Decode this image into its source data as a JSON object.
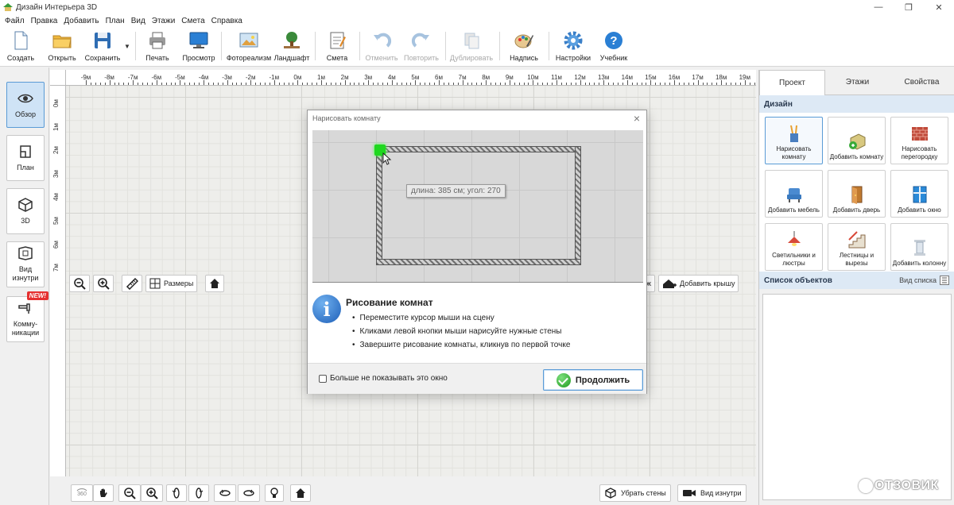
{
  "window": {
    "title": "Дизайн Интерьера 3D"
  },
  "menu": [
    "Файл",
    "Правка",
    "Добавить",
    "План",
    "Вид",
    "Этажи",
    "Смета",
    "Справка"
  ],
  "toolbar": {
    "create": "Создать",
    "open": "Открыть",
    "save": "Сохранить",
    "print": "Печать",
    "preview": "Просмотр",
    "photo": "Фотореализм",
    "landscape": "Ландшафт",
    "estimate": "Смета",
    "undo": "Отменить",
    "redo": "Повторить",
    "duplicate": "Дублировать",
    "label": "Надпись",
    "settings": "Настройки",
    "tutorial": "Учебник"
  },
  "left_nav": {
    "overview": "Обзор",
    "plan": "План",
    "three_d": "3D",
    "inside_view": "Вид изнутри",
    "communications": "Комму-никации",
    "new_badge": "NEW!"
  },
  "ruler_top": [
    "-9м",
    "-8м",
    "-7м",
    "-6м",
    "-5м",
    "-4м",
    "-3м",
    "-2м",
    "-1м",
    "0м",
    "1м",
    "2м",
    "3м",
    "4м",
    "5м",
    "6м",
    "7м",
    "8м",
    "9м",
    "10м",
    "11м",
    "12м",
    "13м",
    "14м",
    "15м",
    "16м",
    "17м",
    "18м",
    "19м"
  ],
  "ruler_left": [
    "0м",
    "1м",
    "2м",
    "3м",
    "4м",
    "5м",
    "6м",
    "7м"
  ],
  "canvas_tools": {
    "dimensions": "Размеры",
    "floor_partial": "таж",
    "add_roof": "Добавить крышу"
  },
  "bottom_tools": {
    "remove_walls": "Убрать стены",
    "inside_view": "Вид изнутри"
  },
  "right_panel": {
    "tabs": [
      "Проект",
      "Этажи",
      "Свойства"
    ],
    "design_header": "Дизайн",
    "design_items": [
      {
        "label": "Нарисовать комнату"
      },
      {
        "label": "Добавить комнату"
      },
      {
        "label": "Нарисовать перегородку"
      },
      {
        "label": "Добавить мебель"
      },
      {
        "label": "Добавить дверь"
      },
      {
        "label": "Добавить окно"
      },
      {
        "label": "Светильники и люстры"
      },
      {
        "label": "Лестницы и вырезы"
      },
      {
        "label": "Добавить колонну"
      }
    ],
    "objects_header": "Список объектов",
    "view_list": "Вид списка"
  },
  "dialog": {
    "title": "Нарисовать комнату",
    "tooltip": "длина: 385 см; угол: 270",
    "heading": "Рисование комнат",
    "bullets": [
      "Переместите курсор мыши на сцену",
      "Кликами левой кнопки мыши нарисуйте нужные стены",
      "Завершите рисование комнаты, кликнув по первой точке"
    ],
    "checkbox": "Больше не показывать это окно",
    "continue": "Продолжить"
  },
  "watermark": "ОТЗОВИК",
  "colors": {
    "accent": "#5a9bd6",
    "header_bg": "#dde9f5",
    "active_btn": "#cfe3f6",
    "start_point": "#1fd81f"
  }
}
